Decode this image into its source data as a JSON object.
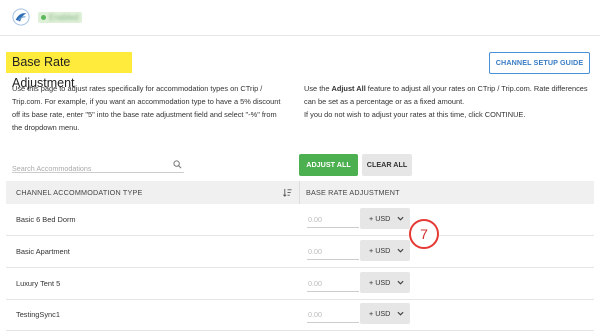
{
  "header": {
    "status_label": "Enabled"
  },
  "page": {
    "title": "Base Rate Adjustment"
  },
  "toolbar": {
    "channel_setup_label": "CHANNEL SETUP GUIDE"
  },
  "description": {
    "left": "Use this page to adjust rates specifically for accommodation types on CTrip / Trip.com. For example, if you want an accommodation type to have a 5% discount off its base rate, enter \"5\" into the base rate adjustment field and select \"-%\" from the dropdown menu.",
    "right_prefix": "Use the ",
    "right_bold": "Adjust All",
    "right_suffix": " feature to adjust all your rates on CTrip / Trip.com. Rate differences can be set as a percentage or as a fixed amount.",
    "right_second": "If you do not wish to adjust your rates at this time, click CONTINUE."
  },
  "search": {
    "placeholder": "Search Accommodations",
    "value": ""
  },
  "actions": {
    "adjust_all_label": "ADJUST ALL",
    "clear_all_label": "CLEAR ALL"
  },
  "table": {
    "col_type": "CHANNEL ACCOMMODATION TYPE",
    "col_adjustment": "BASE RATE ADJUSTMENT",
    "rows": [
      {
        "name": "Basic 6 Bed Dorm",
        "placeholder": "0.00",
        "currency": "+ USD"
      },
      {
        "name": "Basic Apartment",
        "placeholder": "0.00",
        "currency": "+ USD"
      },
      {
        "name": "Luxury Tent 5",
        "placeholder": "0.00",
        "currency": "+ USD"
      },
      {
        "name": "TestingSync1",
        "placeholder": "0.00",
        "currency": "+ USD"
      }
    ]
  },
  "annotation": {
    "step_number": "7"
  },
  "colors": {
    "accent_green": "#4caf50",
    "highlight_yellow": "#ffeb3b",
    "link_blue": "#3a7cc4",
    "annotation_red": "#e53935"
  },
  "icons": [
    "logo-icon",
    "search-icon",
    "sort-icon",
    "chevron-down-icon"
  ]
}
